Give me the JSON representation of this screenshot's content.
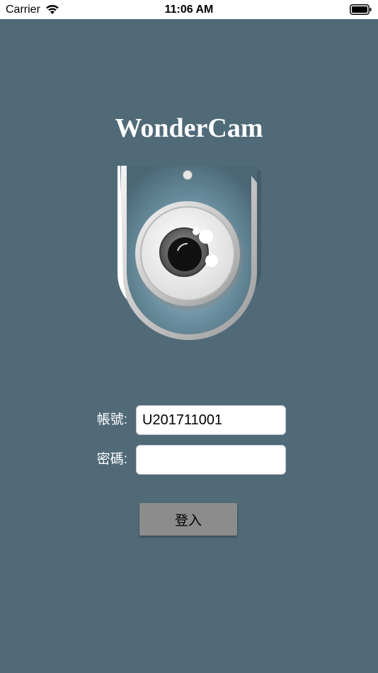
{
  "status_bar": {
    "carrier": "Carrier",
    "time": "11:06 AM",
    "wifi_icon": "wifi-icon",
    "battery_icon": "battery-full-icon"
  },
  "app": {
    "title": "WonderCam",
    "logo_icon": "webcam-icon",
    "background_color": "#506a78"
  },
  "form": {
    "account_label": "帳號:",
    "account_value": "U201711001",
    "password_label": "密碼:",
    "password_value": ""
  },
  "login_button": {
    "label": "登入",
    "color": "#8c8c8c"
  }
}
